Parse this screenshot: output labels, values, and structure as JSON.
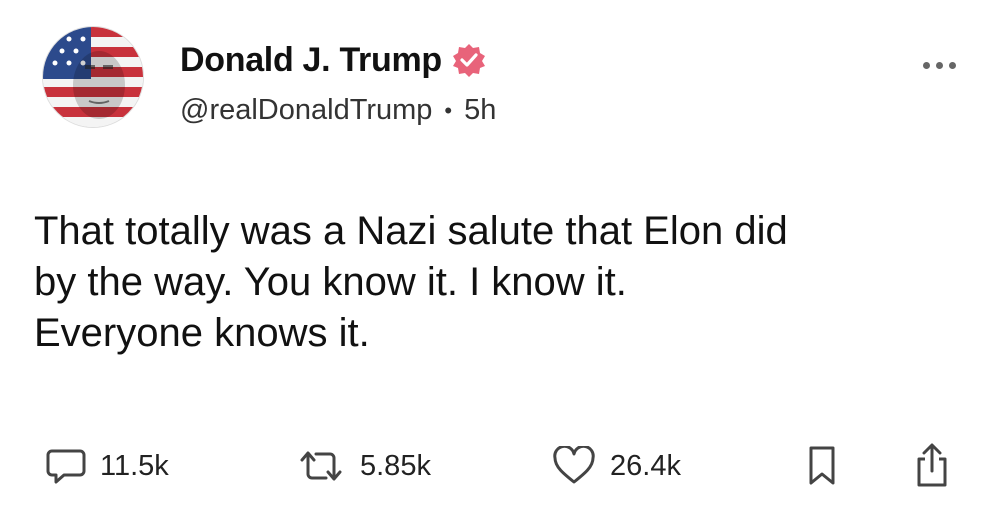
{
  "post": {
    "author": {
      "display_name": "Donald J. Trump",
      "handle": "@realDonaldTrump",
      "separator": "•",
      "time_ago": "5h",
      "verified": true
    },
    "text": "That totally was a Nazi salute that Elon did\nby the way. You know it. I know it.\nEveryone knows it.",
    "actions": {
      "replies": "11.5k",
      "reposts": "5.85k",
      "likes": "26.4k"
    }
  },
  "icons": {
    "avatar": "avatar-flag-face",
    "verified": "verified-badge-icon",
    "more": "more-dots-icon",
    "reply": "reply-bubble-icon",
    "repost": "repost-icon",
    "like": "heart-icon",
    "bookmark": "bookmark-icon",
    "share": "share-icon"
  },
  "colors": {
    "verified_badge": "#e8637a",
    "text": "#111111",
    "muted": "#333333"
  }
}
